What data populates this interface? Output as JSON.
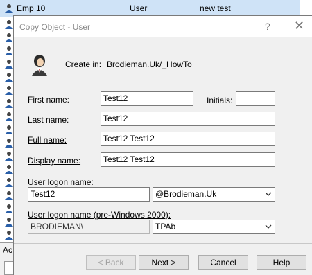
{
  "background": {
    "top_row": {
      "name": "Emp 10",
      "type": "User",
      "description": "new test"
    },
    "bottom_label": "Ac"
  },
  "dialog": {
    "title": "Copy Object - User",
    "help_label": "?",
    "close_label": "✕",
    "create_in_label": "Create in:",
    "create_in_value": "Brodieman.Uk/_HowTo",
    "first_name_label": "First name:",
    "first_name_value": "Test12",
    "initials_label": "Initials:",
    "initials_value": "",
    "last_name_label": "Last name:",
    "last_name_value": "Test12",
    "full_name_label": "Full name:",
    "full_name_value": "Test12 Test12",
    "display_name_label": "Display name:",
    "display_name_value": "Test12 Test12",
    "logon_name_label": "User logon name:",
    "logon_name_value": "Test12",
    "domain_suffix_value": "@Brodieman.Uk",
    "pre2000_label": "User logon name (pre-Windows 2000):",
    "pre2000_domain_value": "BRODIEMAN\\",
    "pre2000_name_value": "TPAb",
    "buttons": {
      "back": "< Back",
      "next": "Next >",
      "cancel": "Cancel",
      "help": "Help"
    }
  }
}
